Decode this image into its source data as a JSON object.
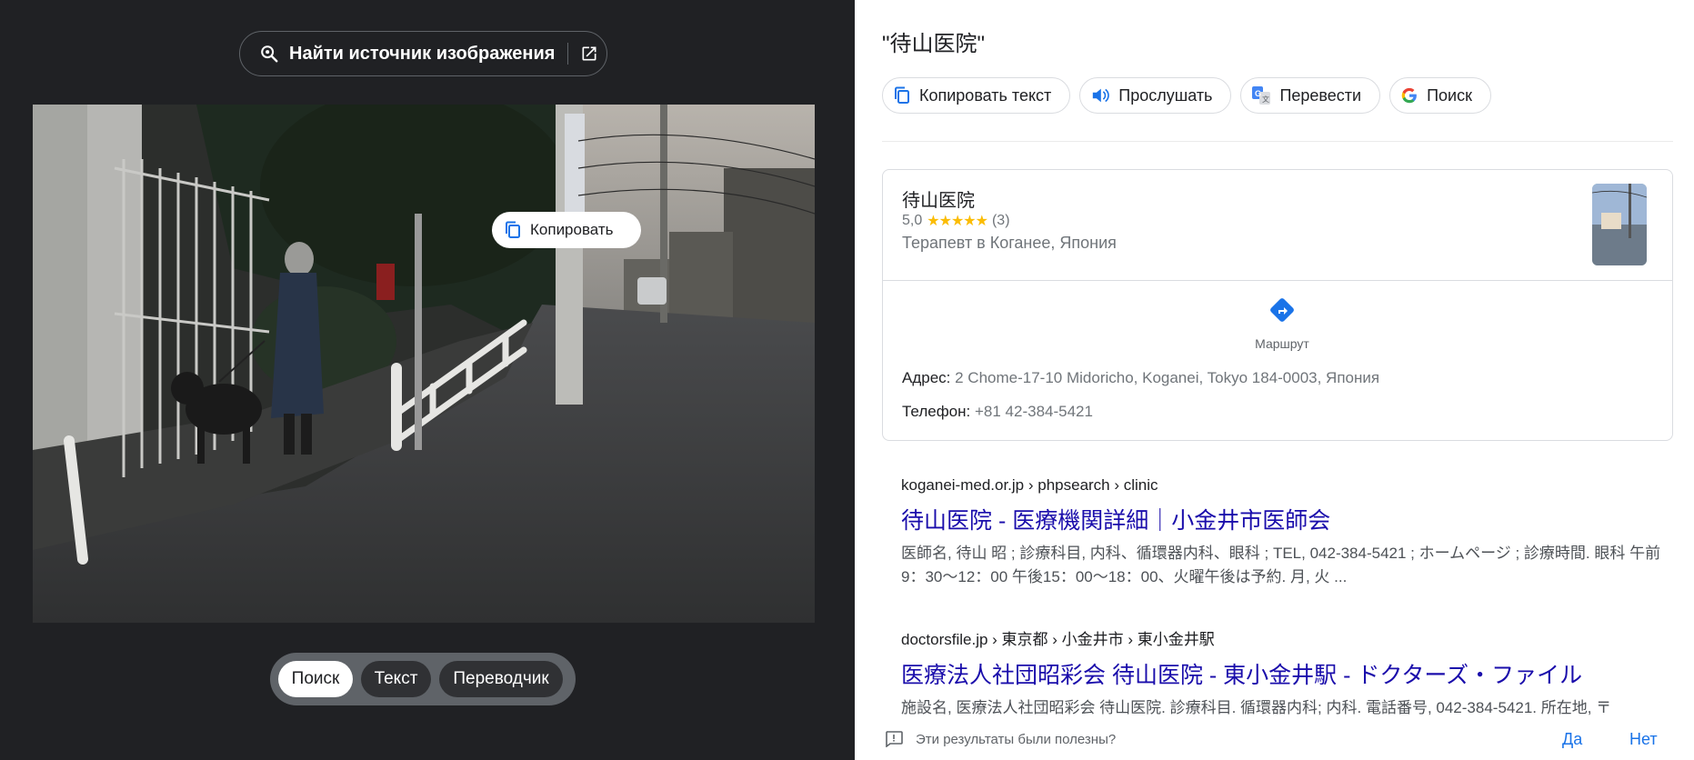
{
  "left": {
    "find_source_label": "Найти источник изображения",
    "copy_chip_label": "Копировать",
    "modes": [
      {
        "label": "Поиск",
        "active": true
      },
      {
        "label": "Текст",
        "active": false
      },
      {
        "label": "Переводчик",
        "active": false
      }
    ]
  },
  "right": {
    "query": "\"待山医院\"",
    "actions": {
      "copy_text": "Копировать текст",
      "listen": "Прослушать",
      "translate": "Перевести",
      "search": "Поиск"
    },
    "place": {
      "name": "待山医院",
      "rating": "5,0",
      "stars": "★★★★★",
      "reviews": "(3)",
      "category": "Терапевт в Коганее, Япония",
      "route_label": "Маршрут",
      "address_label": "Адрес:",
      "address": "2 Chome-17-10 Midoricho, Koganei, Tokyo 184-0003, Япония",
      "phone_label": "Телефон:",
      "phone": "+81 42-384-5421"
    },
    "results": [
      {
        "crumb": "koganei-med.or.jp › phpsearch › clinic",
        "title": "待山医院 - 医療機関詳細｜小金井市医師会",
        "snippet": "医師名, 待山 昭 ; 診療科目, 内科、循環器内科、眼科 ; TEL, 042-384-5421 ; ホームページ ; 診療時間. 眼科 午前9：30～12：00 午後15：00～18：00、火曜午後は予約. 月, 火 ..."
      },
      {
        "crumb": "doctorsfile.jp › 東京都 › 小金井市 › 東小金井駅",
        "title": "医療法人社団昭彩会 待山医院 - 東小金井駅 - ドクターズ・ファイル",
        "snippet": "施設名, 医療法人社団昭彩会 待山医院. 診療科目. 循環器内科; 内科. 電話番号, 042-384-5421. 所在地, 〒"
      }
    ],
    "feedback": {
      "question": "Эти результаты были полезны?",
      "yes": "Да",
      "no": "Нет"
    }
  },
  "colors": {
    "dark_bg": "#202124",
    "link": "#1a0dab",
    "accent": "#1a73e8",
    "star": "#fbbc04"
  }
}
